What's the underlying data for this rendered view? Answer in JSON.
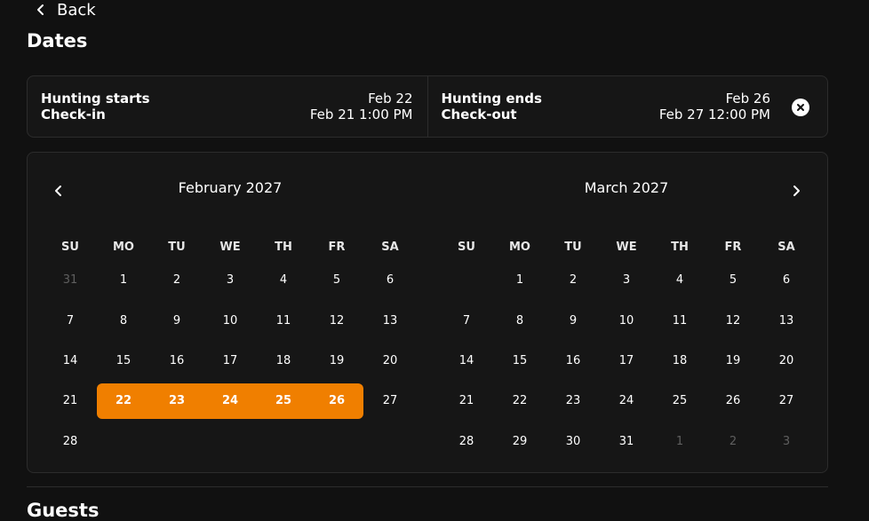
{
  "nav": {
    "back_label": "Back"
  },
  "page": {
    "title": "Dates",
    "next_section": "Guests"
  },
  "dates": {
    "start_label": "Hunting starts",
    "start_date": "Feb 22",
    "checkin_label": "Check-in",
    "checkin_value": "Feb 21 1:00 PM",
    "end_label": "Hunting ends",
    "end_date": "Feb 26",
    "checkout_label": "Check-out",
    "checkout_value": "Feb 27 12:00 PM"
  },
  "colors": {
    "accent": "#f07f00",
    "background": "#111111",
    "card": "#161616"
  },
  "icons": {
    "back": "chevron-left-icon",
    "prev": "chevron-left-icon",
    "next": "chevron-right-icon",
    "clear": "close-icon"
  },
  "calendar": {
    "weekdays": [
      "SU",
      "MO",
      "TU",
      "WE",
      "TH",
      "FR",
      "SA"
    ],
    "months": [
      {
        "title": "February 2027",
        "weeks": [
          [
            {
              "d": "31",
              "m": true
            },
            {
              "d": "1"
            },
            {
              "d": "2"
            },
            {
              "d": "3"
            },
            {
              "d": "4"
            },
            {
              "d": "5"
            },
            {
              "d": "6"
            }
          ],
          [
            {
              "d": "7"
            },
            {
              "d": "8"
            },
            {
              "d": "9"
            },
            {
              "d": "10"
            },
            {
              "d": "11"
            },
            {
              "d": "12"
            },
            {
              "d": "13"
            }
          ],
          [
            {
              "d": "14"
            },
            {
              "d": "15"
            },
            {
              "d": "16"
            },
            {
              "d": "17"
            },
            {
              "d": "18"
            },
            {
              "d": "19"
            },
            {
              "d": "20"
            }
          ],
          [
            {
              "d": "21"
            },
            {
              "d": "22",
              "s": true
            },
            {
              "d": "23",
              "s": true
            },
            {
              "d": "24",
              "s": true
            },
            {
              "d": "25",
              "s": true
            },
            {
              "d": "26",
              "s": true
            },
            {
              "d": "27"
            }
          ],
          [
            {
              "d": "28"
            },
            {
              "d": ""
            },
            {
              "d": ""
            },
            {
              "d": ""
            },
            {
              "d": ""
            },
            {
              "d": ""
            },
            {
              "d": ""
            }
          ]
        ]
      },
      {
        "title": "March 2027",
        "weeks": [
          [
            {
              "d": ""
            },
            {
              "d": "1"
            },
            {
              "d": "2"
            },
            {
              "d": "3"
            },
            {
              "d": "4"
            },
            {
              "d": "5"
            },
            {
              "d": "6"
            }
          ],
          [
            {
              "d": "7"
            },
            {
              "d": "8"
            },
            {
              "d": "9"
            },
            {
              "d": "10"
            },
            {
              "d": "11"
            },
            {
              "d": "12"
            },
            {
              "d": "13"
            }
          ],
          [
            {
              "d": "14"
            },
            {
              "d": "15"
            },
            {
              "d": "16"
            },
            {
              "d": "17"
            },
            {
              "d": "18"
            },
            {
              "d": "19"
            },
            {
              "d": "20"
            }
          ],
          [
            {
              "d": "21"
            },
            {
              "d": "22"
            },
            {
              "d": "23"
            },
            {
              "d": "24"
            },
            {
              "d": "25"
            },
            {
              "d": "26"
            },
            {
              "d": "27"
            }
          ],
          [
            {
              "d": "28"
            },
            {
              "d": "29"
            },
            {
              "d": "30"
            },
            {
              "d": "31"
            },
            {
              "d": "1",
              "m": true
            },
            {
              "d": "2",
              "m": true
            },
            {
              "d": "3",
              "m": true
            }
          ]
        ]
      }
    ]
  }
}
